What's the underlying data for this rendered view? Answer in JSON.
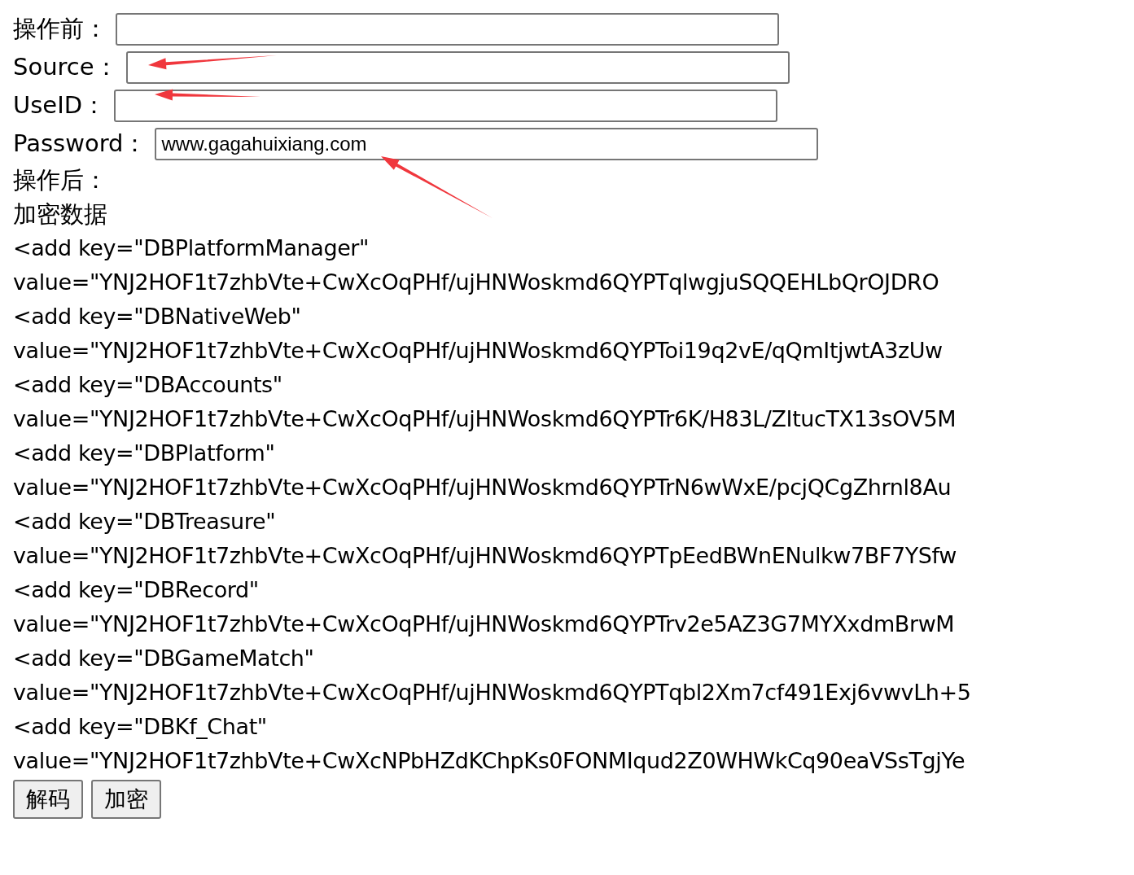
{
  "fields": [
    {
      "label": "操作前："
    },
    {
      "label": "Source："
    },
    {
      "label": "UseID："
    },
    {
      "label": "Password：",
      "value": "www.gagahuixiang.com"
    }
  ],
  "after_label": "操作后：",
  "section_label": "加密数据",
  "lines": [
    "<add key=\"DBPlatformManager\"",
    "value=\"YNJ2HOF1t7zhbVte+CwXcOqPHf/ujHNWoskmd6QYPTqlwgjuSQQEHLbQrOJDRO",
    "<add key=\"DBNativeWeb\"",
    "value=\"YNJ2HOF1t7zhbVte+CwXcOqPHf/ujHNWoskmd6QYPToi19q2vE/qQmItjwtA3zUw",
    "<add key=\"DBAccounts\"",
    "value=\"YNJ2HOF1t7zhbVte+CwXcOqPHf/ujHNWoskmd6QYPTr6K/H83L/ZItucTX13sOV5M",
    "<add key=\"DBPlatform\"",
    "value=\"YNJ2HOF1t7zhbVte+CwXcOqPHf/ujHNWoskmd6QYPTrN6wWxE/pcjQCgZhrnl8Au",
    "<add key=\"DBTreasure\"",
    "value=\"YNJ2HOF1t7zhbVte+CwXcOqPHf/ujHNWoskmd6QYPTpEedBWnENulkw7BF7YSfw",
    "<add key=\"DBRecord\"",
    "value=\"YNJ2HOF1t7zhbVte+CwXcOqPHf/ujHNWoskmd6QYPTrv2e5AZ3G7MYXxdmBrwM",
    "<add key=\"DBGameMatch\"",
    "value=\"YNJ2HOF1t7zhbVte+CwXcOqPHf/ujHNWoskmd6QYPTqbl2Xm7cf491Exj6vwvLh+5",
    "<add key=\"DBKf_Chat\"",
    "value=\"YNJ2HOF1t7zhbVte+CwXcNPbHZdKChpKs0FONMIqud2Z0WHWkCq90eaVSsTgjYe"
  ],
  "buttons": [
    "解码",
    "加密"
  ]
}
